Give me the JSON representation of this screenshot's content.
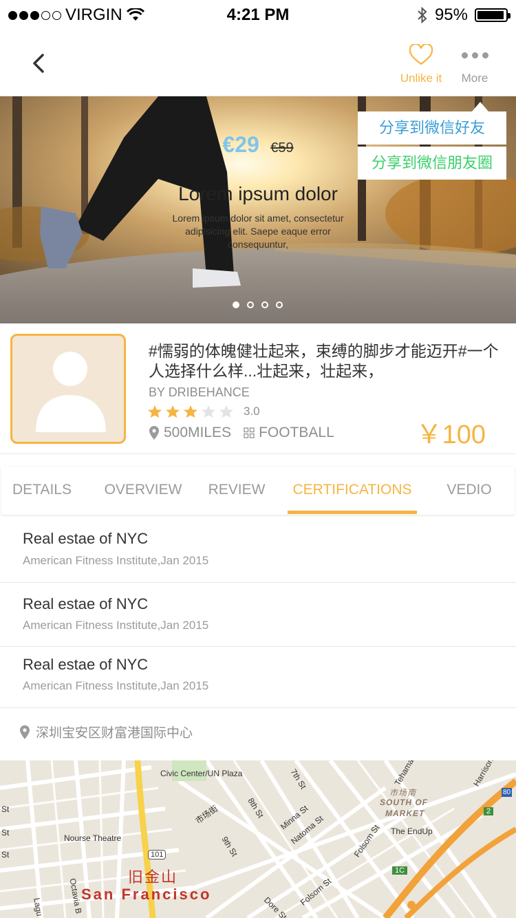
{
  "status_bar": {
    "carrier": "VIRGIN",
    "time": "4:21 PM",
    "battery": "95%",
    "battery_level": 0.95
  },
  "nav": {
    "unlike_label": "Unlike it",
    "more_label": "More"
  },
  "hero": {
    "price_new": "€29",
    "price_old": "€59",
    "title": "Lorem ipsum dolor",
    "description": "Lorem ipsum dolor sit amet, consectetur adipisicing elit. Saepe eaque error consequuntur,",
    "slide_count": 4,
    "active_slide": 1
  },
  "share_menu": {
    "items": [
      "分享到微信好友",
      "分享到微信朋友圈"
    ]
  },
  "product": {
    "title": "#懦弱的体魄健壮起来，束缚的脚步才能迈开#一个人选择什么样...壮起来，壮起来，",
    "author": "BY DRIBEHANCE",
    "rating": 3,
    "rating_max": 5,
    "rating_text": "3.0",
    "distance": "500MILES",
    "category": "FOOTBALL",
    "price": "￥100"
  },
  "tabs": {
    "items": [
      "DETAILS",
      "OVERVIEW",
      "REVIEW",
      "CERTIFICATIONS",
      "VEDIO"
    ],
    "active": "CERTIFICATIONS"
  },
  "certifications": [
    {
      "title": "Real estae of NYC",
      "subtitle": "American Fitness Institute,Jan 2015"
    },
    {
      "title": "Real estae of NYC",
      "subtitle": "American Fitness Institute,Jan 2015"
    },
    {
      "title": "Real estae of NYC",
      "subtitle": "American Fitness Institute,Jan 2015"
    }
  ],
  "location": "深圳宝安区财富港国际中心",
  "map": {
    "labels": {
      "civic_center": "Civic Center/UN Plaza",
      "nourse": "Nourse Theatre",
      "the_endup": "The EndUp",
      "shichang": "市场街",
      "shichangnan": "市场南",
      "south_of_market": "SOUTH OF",
      "market": "MARKET",
      "seventh": "7th St",
      "eighth": "8th St",
      "ninth": "9th St",
      "minna": "Minna St",
      "natoma": "Natoma St",
      "folsom": "Folsom St",
      "folsom2": "Folsom St",
      "dore": "Dore St",
      "octavia": "Octavia B",
      "tehama": "Tehama",
      "harrison": "Harrison",
      "route101": "101",
      "route80": "80",
      "badge2": "2",
      "badge1c": "1C",
      "st_a": "St",
      "st_b": "St",
      "st_c": "St",
      "lagu": "Lagu"
    },
    "city_cn": "旧金山",
    "city_en": "San Francisco"
  },
  "colors": {
    "accent": "#f6b443",
    "price_blue": "#7fc4ec",
    "share_friend": "#3a9ed8",
    "share_moments": "#3ccf6b",
    "map_city": "#c2352b"
  }
}
